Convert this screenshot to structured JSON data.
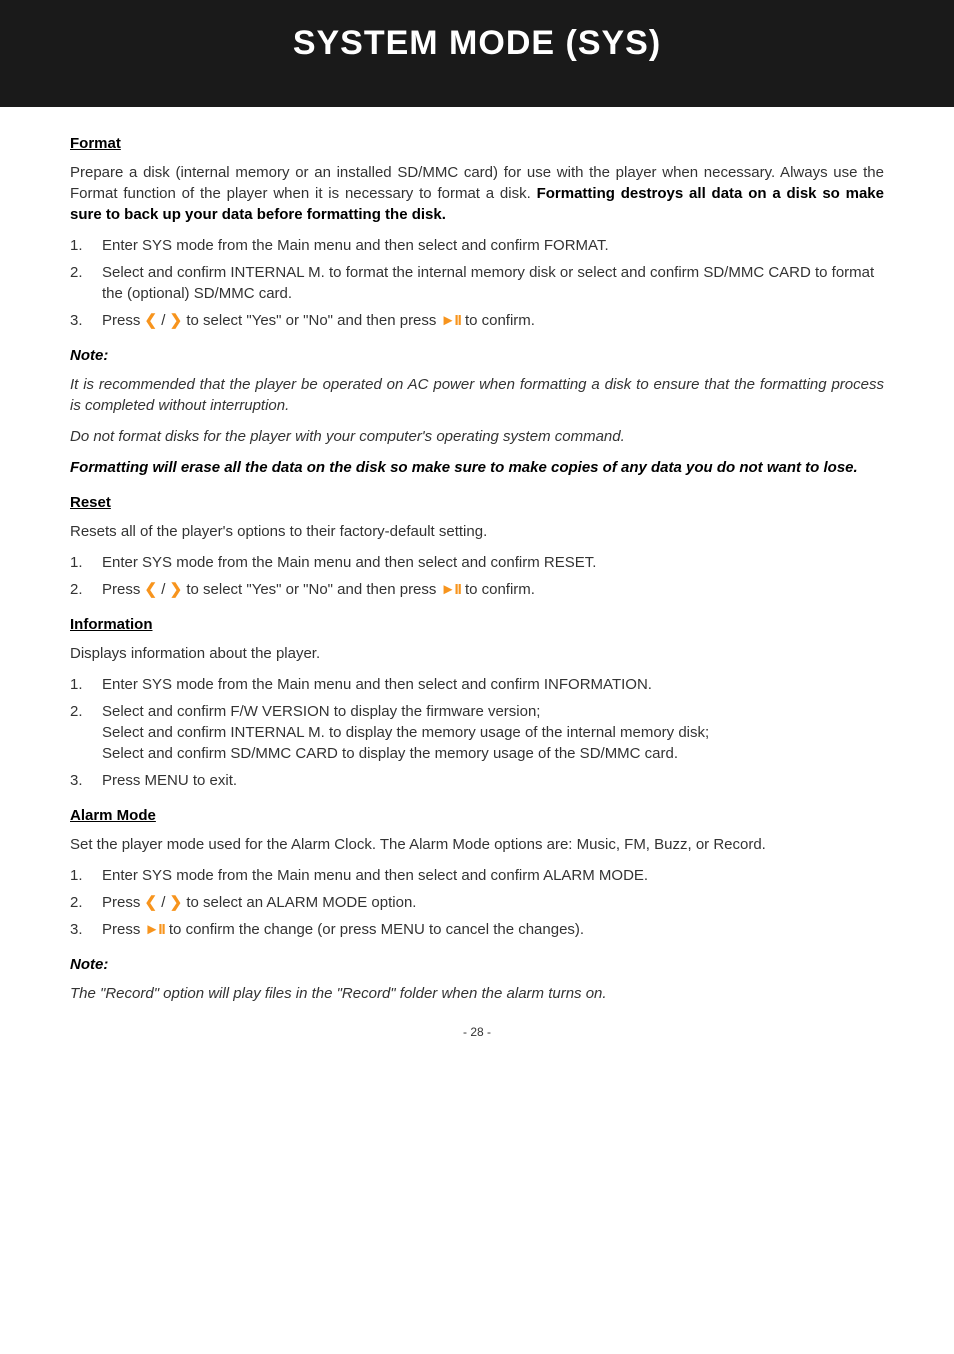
{
  "header": {
    "title": "SYSTEM MODE (SYS)"
  },
  "format": {
    "title": "Format",
    "intro_plain": "Prepare a disk (internal memory or an installed SD/MMC card) for use with the player when necessary. Always use the Format function of the player when it is necessary to format a disk. ",
    "intro_bold": "Formatting destroys all data on a disk so make sure to back up your data before formatting the disk.",
    "li1": "Enter SYS mode from the Main menu and then select and confirm FORMAT.",
    "li2": "Select and confirm INTERNAL M. to format the internal memory disk or select and confirm SD/MMC CARD to format the (optional) SD/MMC card.",
    "li3_a": "Press ",
    "li3_b": " / ",
    "li3_c": " to select \"Yes\" or \"No\" and then press ",
    "li3_d": " to confirm."
  },
  "note1": {
    "label": "Note:",
    "p1": "It is recommended that the player be operated on AC power when formatting a disk to ensure that the formatting process is completed without interruption.",
    "p2": "Do not format disks for the player with your computer's operating system command.",
    "p3": "Formatting will erase all the data on the disk so make sure to make copies of any data you do not want to lose."
  },
  "reset": {
    "title": "Reset",
    "intro": "Resets all of the player's options to their factory-default setting.",
    "li1": "Enter SYS mode from the Main menu and then select and confirm RESET.",
    "li2_a": "Press ",
    "li2_b": " / ",
    "li2_c": " to select \"Yes\" or \"No\" and then press ",
    "li2_d": " to confirm."
  },
  "info": {
    "title": "Information",
    "intro": "Displays information about the player.",
    "li1": "Enter SYS mode from the Main menu and then select and confirm INFORMATION.",
    "li2": "Select and confirm F/W VERSION to display the firmware version;\nSelect and confirm INTERNAL M. to display the memory usage of the internal memory disk;\nSelect and confirm SD/MMC CARD to display the memory usage of the SD/MMC card.",
    "li3": "Press MENU to exit."
  },
  "alarm": {
    "title": "Alarm Mode",
    "intro": "Set the player mode used for the Alarm Clock. The Alarm Mode options are: Music, FM, Buzz, or Record.",
    "li1": "Enter SYS mode from the Main menu and then select and confirm ALARM MODE.",
    "li2_a": "Press ",
    "li2_b": " / ",
    "li2_c": " to select an ALARM MODE option.",
    "li3_a": "Press ",
    "li3_b": " to confirm the change (or press MENU to cancel the changes)."
  },
  "note2": {
    "label": "Note:",
    "p1": "The \"Record\" option will play files in the \"Record\" folder when the alarm turns on."
  },
  "icons": {
    "left": "❮",
    "right": "❯",
    "play": "►",
    "pause": "II"
  },
  "footer": {
    "page": "- 28 -"
  }
}
